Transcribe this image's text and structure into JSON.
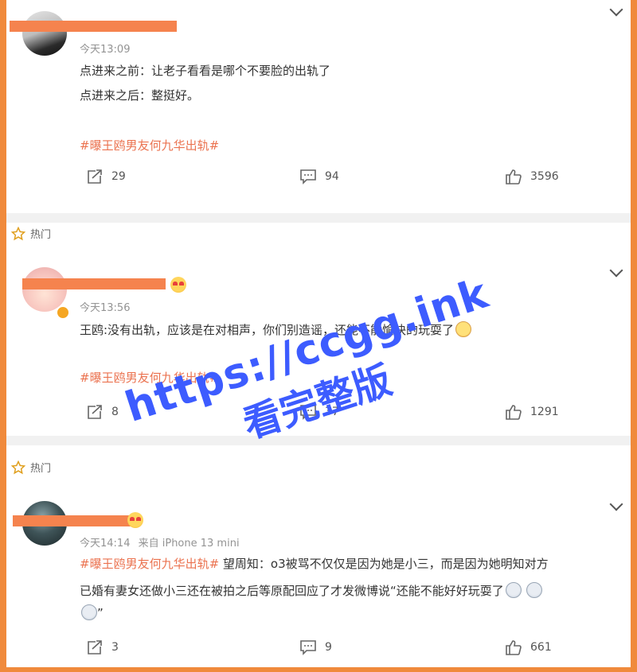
{
  "comments": [
    {
      "time": "今天13:09",
      "lines": [
        "点进来之前：让老子看看是哪个不要脸的出轨了",
        "点进来之后：整挺好。"
      ],
      "hashtag": "#曝王鸥男友何九华出轨#",
      "repost_count": "29",
      "comment_count": "94",
      "like_count": "3596"
    },
    {
      "hot_label": "热门",
      "time": "今天13:56",
      "lines": [
        "王鸥:没有出轨，应该是在对相声，你们别造谣，还能不能愉快的玩耍了"
      ],
      "hashtag": "#曝王鸥男友何九华出轨#",
      "repost_count": "8",
      "comment_count": "37",
      "like_count": "1291"
    },
    {
      "hot_label": "热门",
      "time": "今天14:14",
      "source": "来自 iPhone 13 mini",
      "hashtag": "#曝王鸥男友何九华出轨#",
      "line1_rest": " 望周知：o3被骂不仅仅是因为她是小三，而是因为她明知对方",
      "line2": "已婚有妻女还做小三还在被拍之后等原配回应了才发微博说“还能不能好好玩耍了",
      "line3": "”",
      "repost_count": "3",
      "comment_count": "9",
      "like_count": "661"
    }
  ],
  "watermark": {
    "url": "https://ccgg.ink",
    "text": "看完整版"
  },
  "colors": {
    "border": "#f08a3c",
    "hashtag": "#eb7350",
    "watermark": "#3d5cff"
  }
}
